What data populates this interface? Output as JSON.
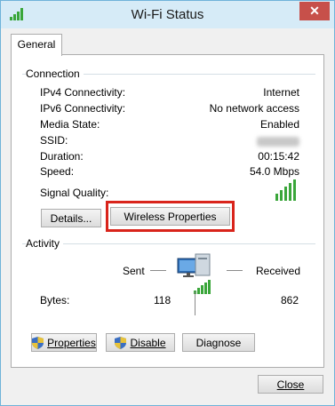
{
  "window": {
    "title": "Wi-Fi Status"
  },
  "tabs": [
    {
      "label": "General"
    }
  ],
  "connection": {
    "header": "Connection",
    "rows": [
      {
        "label": "IPv4 Connectivity:",
        "value": "Internet"
      },
      {
        "label": "IPv6 Connectivity:",
        "value": "No network access"
      },
      {
        "label": "Media State:",
        "value": "Enabled"
      },
      {
        "label": "SSID:",
        "value": ""
      },
      {
        "label": "Duration:",
        "value": "00:15:42"
      },
      {
        "label": "Speed:",
        "value": "54.0 Mbps"
      }
    ],
    "signal_label": "Signal Quality:",
    "signal_bars_filled": 5,
    "details_button": "Details...",
    "wireless_button": "Wireless Properties"
  },
  "activity": {
    "header": "Activity",
    "sent_label": "Sent",
    "received_label": "Received",
    "bytes_label": "Bytes:",
    "bytes_sent": "118",
    "bytes_received": "862"
  },
  "buttons": {
    "properties": "Properties",
    "disable": "Disable",
    "diagnose": "Diagnose",
    "close": "Close"
  },
  "colors": {
    "highlight": "#d9241b",
    "signal": "#3aa63a",
    "titlebar": "#d6ebf7"
  }
}
